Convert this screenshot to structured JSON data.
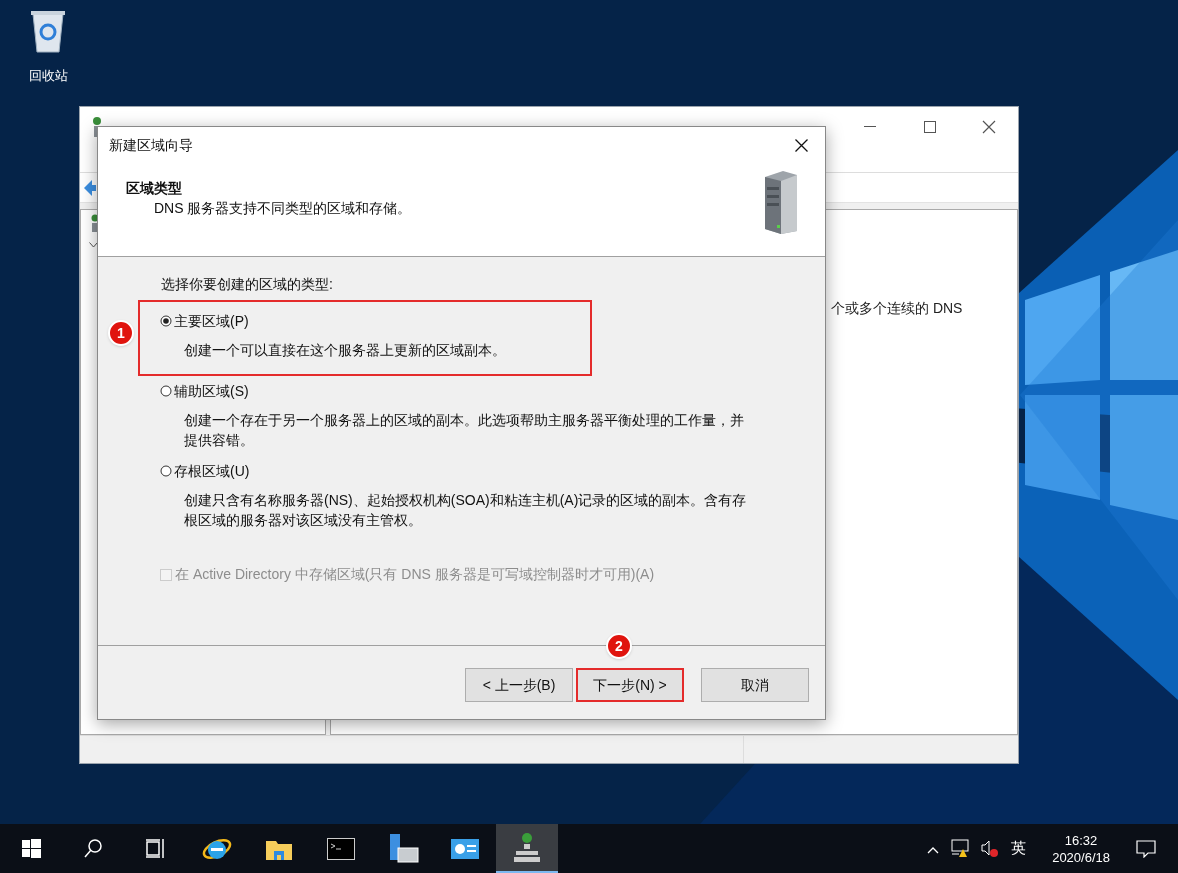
{
  "desktop": {
    "icons": [
      {
        "kind": "recycle-bin",
        "label": "回收站"
      }
    ]
  },
  "dns_window": {
    "right_pane_text": "个或多个连续的 DNS"
  },
  "wizard": {
    "title": "新建区域向导",
    "heading": "区域类型",
    "subtitle": "DNS 服务器支持不同类型的区域和存储。",
    "prompt": "选择你要创建的区域的类型:",
    "options": [
      {
        "label": "主要区域(P)",
        "description": "创建一个可以直接在这个服务器上更新的区域副本。",
        "selected": true,
        "highlighted": true,
        "badge": "1"
      },
      {
        "label": "辅助区域(S)",
        "description": "创建一个存在于另一个服务器上的区域的副本。此选项帮助主服务器平衡处理的工作量，并提供容错。",
        "selected": false,
        "highlighted": false
      },
      {
        "label": "存根区域(U)",
        "description": "创建只含有名称服务器(NS)、起始授权机构(SOA)和粘连主机(A)记录的区域的副本。含有存根区域的服务器对该区域没有主管权。",
        "selected": false,
        "highlighted": false
      }
    ],
    "store_in_ad": {
      "label": "在 Active Directory 中存储区域(只有 DNS 服务器是可写域控制器时才可用)(A)",
      "checked": false,
      "disabled": true
    },
    "buttons": [
      {
        "kind": "back",
        "label": "< 上一步(B)",
        "highlighted": false
      },
      {
        "kind": "next",
        "label": "下一步(N) >",
        "highlighted": true,
        "badge": "2"
      },
      {
        "kind": "cancel",
        "label": "取消",
        "highlighted": false
      }
    ]
  },
  "taskbar": {
    "apps": [
      {
        "kind": "start",
        "active": false
      },
      {
        "kind": "search",
        "active": false
      },
      {
        "kind": "task-view",
        "active": false
      },
      {
        "kind": "browser",
        "active": false
      },
      {
        "kind": "folder",
        "active": false
      },
      {
        "kind": "terminal",
        "active": false
      },
      {
        "kind": "server-manager",
        "active": false
      },
      {
        "kind": "control-panel",
        "active": false
      },
      {
        "kind": "dns",
        "active": true
      }
    ],
    "tray": {
      "language": "英",
      "time": "16:32",
      "date": "2020/6/18"
    }
  }
}
